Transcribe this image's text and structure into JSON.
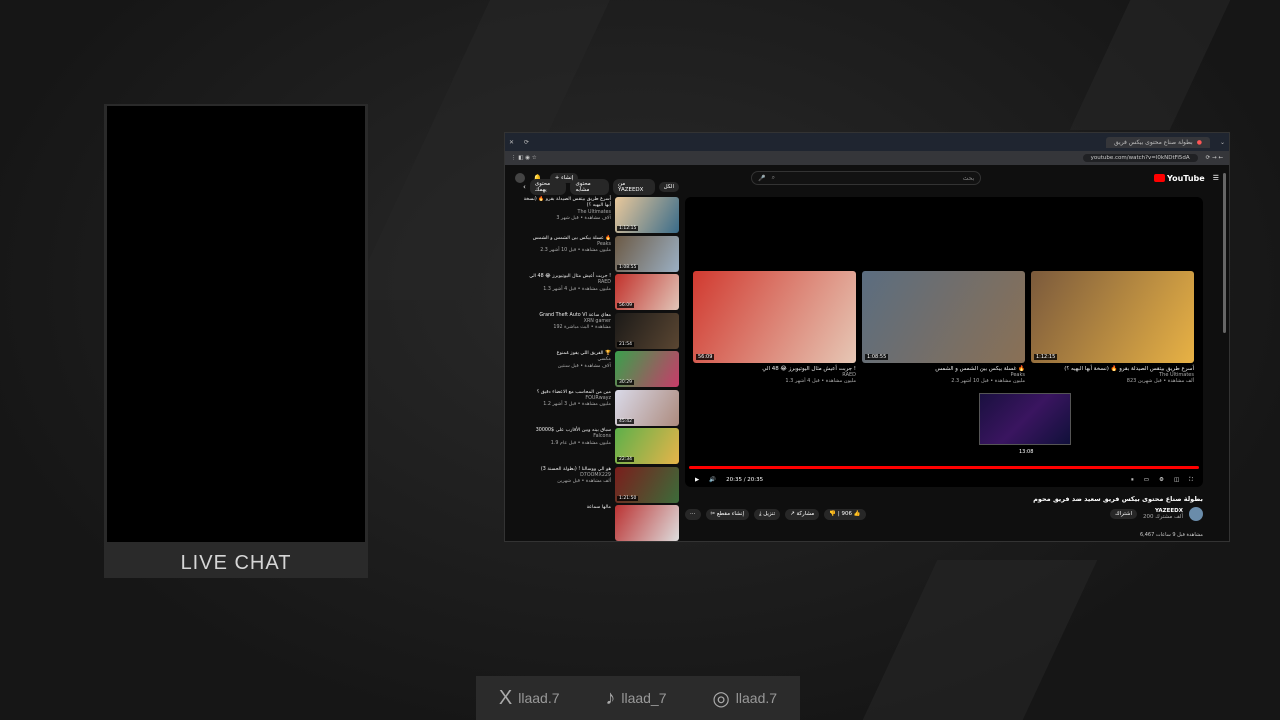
{
  "overlay": {
    "chat_label": "LIVE CHAT",
    "socials": [
      {
        "icon": "x-icon",
        "glyph": "X",
        "handle": "llaad.7"
      },
      {
        "icon": "tiktok-icon",
        "glyph": "♪",
        "handle": "llaad_7"
      },
      {
        "icon": "instagram-icon",
        "glyph": "◎",
        "handle": "llaad.7"
      }
    ]
  },
  "browser": {
    "tab_title": "بطولة صناع محتوى بيكس فريق",
    "url": "youtube.com/watch?v=l0kNDtFi5dA"
  },
  "youtube": {
    "logo": "YouTube",
    "search_placeholder": "بحث",
    "create_label": "إنشاء",
    "chips": [
      "الكل",
      "من YAZEEDX",
      "محتوى مشابه",
      "محتوى يهمك"
    ],
    "sidebar": [
      {
        "title": "أسرع طريق بيتقس الصيدلة بقرو 🔥 (نسخة أبها البهيه ؟)",
        "channel": "The Ultimates",
        "stats": "3 آلاف مشاهدة • قبل شهر",
        "dur": "1:12:15",
        "c1": "#e9c89b",
        "c2": "#3a6c8a"
      },
      {
        "title": "غسلة بيكس بين الشمس و الشمس 🔥",
        "channel": "Peaks",
        "stats": "2.3 مليون مشاهدة • قبل 10 أشهر",
        "dur": "1:08:55",
        "c1": "#6c5a45",
        "c2": "#9bb0c4"
      },
      {
        "title": "جربت أعيش مثال اليوتيوبرز 😂 48 الي !",
        "channel": "RAED",
        "stats": "1.3 مليون مشاهدة • قبل 4 أشهر",
        "dur": "56:09",
        "c1": "#c2322c",
        "c2": "#e1c5b8"
      },
      {
        "title": "Grand Theft Auto VI معاي ساعة",
        "channel": "XRN gamer",
        "stats": "192 مشاهدة • البث مباشرة",
        "dur": "21:54",
        "c1": "#1c1a18",
        "c2": "#5a4632"
      },
      {
        "title": "الفريق اللي يفوز مُمنوع 🏆",
        "channel": "مكسي",
        "stats": "آلاف مشاهدة • قبل سنتين",
        "dur": "30:29",
        "c1": "#3aa04c",
        "c2": "#c83c6a"
      },
      {
        "title": "مين من المحاسب مع الاعضاء دقيق ؟",
        "channel": "FOURwayz",
        "stats": "1.2 مليون مشاهدة • قبل 3 أشهر",
        "dur": "45:42",
        "c1": "#d9d9e8",
        "c2": "#ad8b7e"
      },
      {
        "title": "سباق بينه وبين الأقارب على $30000",
        "channel": "Falcons",
        "stats": "1.9 مليون مشاهدة • قبل عام",
        "dur": "22:34",
        "c1": "#5db04a",
        "c2": "#e7b44a"
      },
      {
        "title": "هو الي ووسالنا ! (بطولة الحسنة 3)",
        "channel": "D7OOMX229",
        "stats": "ألف مشاهدة • قبل شهرين",
        "dur": "1:21:50",
        "c1": "#7a1e1c",
        "c2": "#3c6c3a"
      },
      {
        "title": "مالها سماعة",
        "channel": "",
        "stats": "",
        "dur": "",
        "c1": "#b33",
        "c2": "#ddd"
      }
    ],
    "endscreen": [
      {
        "title": "جربت أعيش مثال اليوتيوبرز 😂 48 الي !",
        "channel": "RAED",
        "stats": "1.3 مليون مشاهدة • قبل 4 أشهر",
        "dur": "56:09",
        "c1": "#d13a30",
        "c2": "#e6c7b5"
      },
      {
        "title": "غسلة بيكس بين الشمس و الشمس 🔥",
        "channel": "Peaks",
        "stats": "2.3 مليون مشاهدة • قبل 10 أشهر",
        "dur": "1:08:55",
        "c1": "#5b6d80",
        "c2": "#8a7055"
      },
      {
        "title": "أسرع طريق بيتقس الصيدلة بقرو 🔥 (نسخة أبها البهيه ؟)",
        "channel": "The Ultimates",
        "stats": "823 ألف مشاهدة • قبل شهرين",
        "dur": "1:12:15",
        "c1": "#7b5a3c",
        "c2": "#e8b245"
      }
    ],
    "mini_time": "13:08",
    "time": "20:35 / 20:35",
    "video_title": "بطولة صناع محتوى بيكس فريق سعيد ضد فريق محوم",
    "channel_name": "YAZEEDX",
    "subscribers": "200 ألف مشترك",
    "join": "اشتراك",
    "likes": "906",
    "share": "مشاركة",
    "download": "تنزيل",
    "clip": "إنشاء مقطع",
    "views": "6,467 مشاهدة قبل 9 ساعات"
  }
}
